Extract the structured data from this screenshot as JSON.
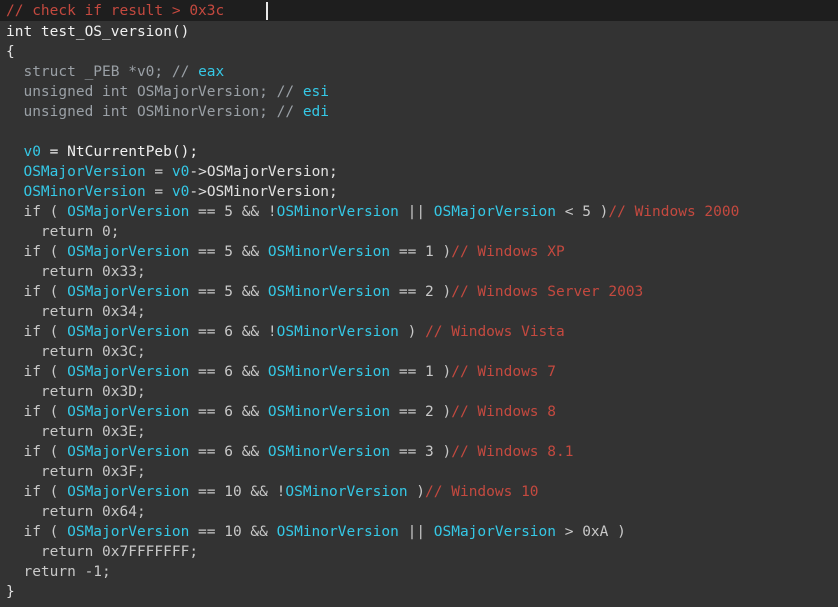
{
  "header": {
    "comment_line": "// check if result > 0x3c"
  },
  "code": {
    "lines": [
      [
        {
          "t": "int test_OS_version()",
          "c": "t-fn"
        }
      ],
      [
        {
          "t": "{",
          "c": "t-default"
        }
      ],
      [
        {
          "t": "  struct _PEB *v0; ",
          "c": "t-type"
        },
        {
          "t": "// ",
          "c": "t-type"
        },
        {
          "t": "eax",
          "c": "t-var"
        }
      ],
      [
        {
          "t": "  unsigned int OSMajorVersion; ",
          "c": "t-type"
        },
        {
          "t": "// ",
          "c": "t-type"
        },
        {
          "t": "esi",
          "c": "t-var"
        }
      ],
      [
        {
          "t": "  unsigned int OSMinorVersion; ",
          "c": "t-type"
        },
        {
          "t": "// ",
          "c": "t-type"
        },
        {
          "t": "edi",
          "c": "t-var"
        }
      ],
      [
        {
          "t": "",
          "c": "t-default"
        }
      ],
      [
        {
          "t": "  ",
          "c": "t-default"
        },
        {
          "t": "v0",
          "c": "t-var"
        },
        {
          "t": " = NtCurrentPeb();",
          "c": "t-fn"
        }
      ],
      [
        {
          "t": "  ",
          "c": "t-default"
        },
        {
          "t": "OSMajorVersion",
          "c": "t-var"
        },
        {
          "t": " = ",
          "c": "t-op"
        },
        {
          "t": "v0",
          "c": "t-var"
        },
        {
          "t": "->OSMajorVersion;",
          "c": "t-default"
        }
      ],
      [
        {
          "t": "  ",
          "c": "t-default"
        },
        {
          "t": "OSMinorVersion",
          "c": "t-var"
        },
        {
          "t": " = ",
          "c": "t-op"
        },
        {
          "t": "v0",
          "c": "t-var"
        },
        {
          "t": "->OSMinorVersion;",
          "c": "t-default"
        }
      ],
      [
        {
          "t": "  if ( ",
          "c": "t-kw"
        },
        {
          "t": "OSMajorVersion",
          "c": "t-var"
        },
        {
          "t": " == 5 && !",
          "c": "t-op"
        },
        {
          "t": "OSMinorVersion",
          "c": "t-var"
        },
        {
          "t": " || ",
          "c": "t-op"
        },
        {
          "t": "OSMajorVersion",
          "c": "t-var"
        },
        {
          "t": " < 5 )",
          "c": "t-op"
        },
        {
          "t": "// Windows 2000",
          "c": "t-cmt"
        }
      ],
      [
        {
          "t": "    return 0;",
          "c": "t-kw"
        }
      ],
      [
        {
          "t": "  if ( ",
          "c": "t-kw"
        },
        {
          "t": "OSMajorVersion",
          "c": "t-var"
        },
        {
          "t": " == 5 && ",
          "c": "t-op"
        },
        {
          "t": "OSMinorVersion",
          "c": "t-var"
        },
        {
          "t": " == 1 )",
          "c": "t-op"
        },
        {
          "t": "// Windows XP",
          "c": "t-cmt"
        }
      ],
      [
        {
          "t": "    return 0x33;",
          "c": "t-kw"
        }
      ],
      [
        {
          "t": "  if ( ",
          "c": "t-kw"
        },
        {
          "t": "OSMajorVersion",
          "c": "t-var"
        },
        {
          "t": " == 5 && ",
          "c": "t-op"
        },
        {
          "t": "OSMinorVersion",
          "c": "t-var"
        },
        {
          "t": " == 2 )",
          "c": "t-op"
        },
        {
          "t": "// Windows Server 2003",
          "c": "t-cmt"
        }
      ],
      [
        {
          "t": "    return 0x34;",
          "c": "t-kw"
        }
      ],
      [
        {
          "t": "  if ( ",
          "c": "t-kw"
        },
        {
          "t": "OSMajorVersion",
          "c": "t-var"
        },
        {
          "t": " == 6 && !",
          "c": "t-op"
        },
        {
          "t": "OSMinorVersion",
          "c": "t-var"
        },
        {
          "t": " ) ",
          "c": "t-op"
        },
        {
          "t": "// Windows Vista",
          "c": "t-cmt"
        }
      ],
      [
        {
          "t": "    return 0x3C;",
          "c": "t-kw"
        }
      ],
      [
        {
          "t": "  if ( ",
          "c": "t-kw"
        },
        {
          "t": "OSMajorVersion",
          "c": "t-var"
        },
        {
          "t": " == 6 && ",
          "c": "t-op"
        },
        {
          "t": "OSMinorVersion",
          "c": "t-var"
        },
        {
          "t": " == 1 )",
          "c": "t-op"
        },
        {
          "t": "// Windows 7",
          "c": "t-cmt"
        }
      ],
      [
        {
          "t": "    return 0x3D;",
          "c": "t-kw"
        }
      ],
      [
        {
          "t": "  if ( ",
          "c": "t-kw"
        },
        {
          "t": "OSMajorVersion",
          "c": "t-var"
        },
        {
          "t": " == 6 && ",
          "c": "t-op"
        },
        {
          "t": "OSMinorVersion",
          "c": "t-var"
        },
        {
          "t": " == 2 )",
          "c": "t-op"
        },
        {
          "t": "// Windows 8",
          "c": "t-cmt"
        }
      ],
      [
        {
          "t": "    return 0x3E;",
          "c": "t-kw"
        }
      ],
      [
        {
          "t": "  if ( ",
          "c": "t-kw"
        },
        {
          "t": "OSMajorVersion",
          "c": "t-var"
        },
        {
          "t": " == 6 && ",
          "c": "t-op"
        },
        {
          "t": "OSMinorVersion",
          "c": "t-var"
        },
        {
          "t": " == 3 )",
          "c": "t-op"
        },
        {
          "t": "// Windows 8.1",
          "c": "t-cmt"
        }
      ],
      [
        {
          "t": "    return 0x3F;",
          "c": "t-kw"
        }
      ],
      [
        {
          "t": "  if ( ",
          "c": "t-kw"
        },
        {
          "t": "OSMajorVersion",
          "c": "t-var"
        },
        {
          "t": " == 10 && !",
          "c": "t-op"
        },
        {
          "t": "OSMinorVersion",
          "c": "t-var"
        },
        {
          "t": " )",
          "c": "t-op"
        },
        {
          "t": "// Windows 10",
          "c": "t-cmt"
        }
      ],
      [
        {
          "t": "    return 0x64;",
          "c": "t-kw"
        }
      ],
      [
        {
          "t": "  if ( ",
          "c": "t-kw"
        },
        {
          "t": "OSMajorVersion",
          "c": "t-var"
        },
        {
          "t": " == 10 && ",
          "c": "t-op"
        },
        {
          "t": "OSMinorVersion",
          "c": "t-var"
        },
        {
          "t": " || ",
          "c": "t-op"
        },
        {
          "t": "OSMajorVersion",
          "c": "t-var"
        },
        {
          "t": " > 0xA )",
          "c": "t-op"
        }
      ],
      [
        {
          "t": "    return 0x7FFFFFFF;",
          "c": "t-kw"
        }
      ],
      [
        {
          "t": "  return -1;",
          "c": "t-kw"
        }
      ],
      [
        {
          "t": "}",
          "c": "t-default"
        }
      ]
    ]
  }
}
